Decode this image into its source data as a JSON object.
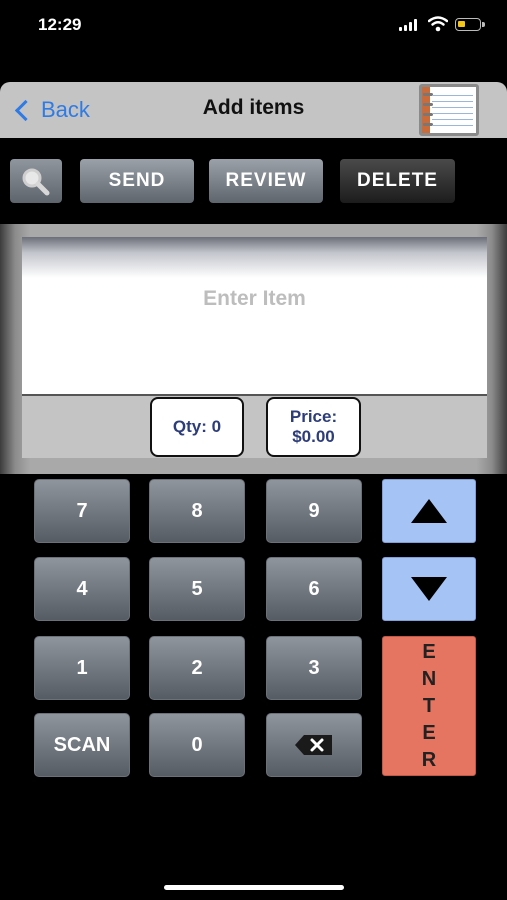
{
  "status_bar": {
    "time": "12:29"
  },
  "nav": {
    "back_label": "Back",
    "title": "Add items",
    "list_icon": "notebook-icon"
  },
  "toolbar": {
    "search_icon": "search-icon",
    "send_label": "SEND",
    "review_label": "REVIEW",
    "delete_label": "DELETE"
  },
  "entry": {
    "placeholder": "Enter Item"
  },
  "qty": {
    "label": "Qty: 0"
  },
  "price": {
    "label": "Price:",
    "value": "$0.00"
  },
  "keypad": {
    "keys": [
      "7",
      "8",
      "9",
      "4",
      "5",
      "6",
      "1",
      "2",
      "3",
      "SCAN",
      "0"
    ],
    "backspace_icon": "backspace-icon",
    "up_icon": "arrow-up-icon",
    "down_icon": "arrow-down-icon",
    "enter_letters": [
      "E",
      "N",
      "T",
      "E",
      "R"
    ]
  },
  "colors": {
    "accent_blue": "#2f7be5",
    "arrow_key_bg": "#a6c3f5",
    "enter_key_bg": "#e57561",
    "price_text": "#2d3d7a"
  }
}
